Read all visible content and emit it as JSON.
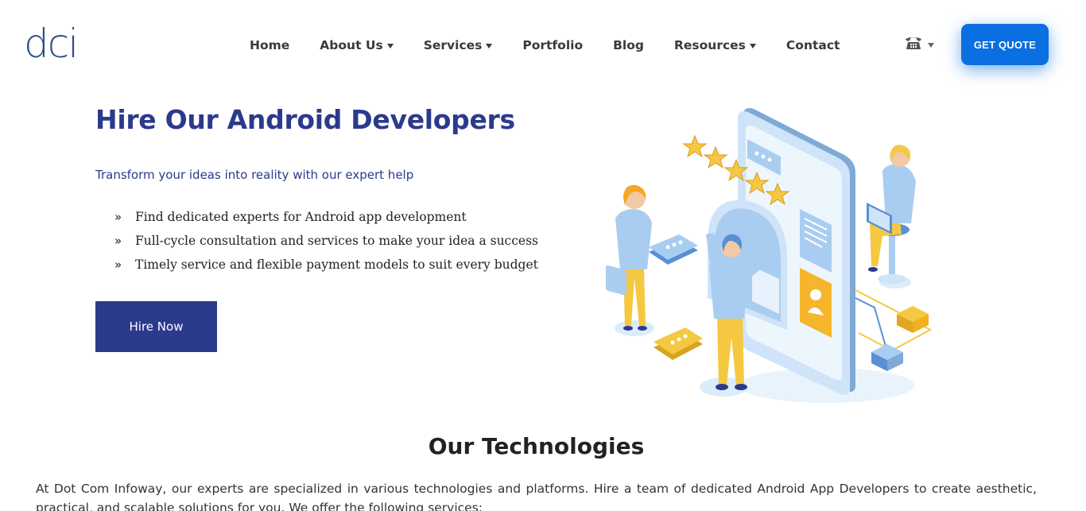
{
  "header": {
    "logo_text": "dci",
    "nav": [
      {
        "label": "Home",
        "dropdown": false
      },
      {
        "label": "About Us",
        "dropdown": true
      },
      {
        "label": "Services",
        "dropdown": true
      },
      {
        "label": "Portfolio",
        "dropdown": false
      },
      {
        "label": "Blog",
        "dropdown": false
      },
      {
        "label": "Resources",
        "dropdown": true
      },
      {
        "label": "Contact",
        "dropdown": false
      }
    ],
    "phone_icon": "phone-icon",
    "cta_label": "GET QUOTE"
  },
  "hero": {
    "title": "Hire Our Android Developers",
    "subtitle": "Transform your ideas into reality with our expert help",
    "bullet_icon": "»",
    "bullets": [
      "Find dedicated experts for Android app development",
      "Full-cycle consultation and services to make your idea a success",
      "Timely service and flexible payment models to suit every budget"
    ],
    "button_label": "Hire Now"
  },
  "technologies": {
    "title": "Our Technologies",
    "intro": "At Dot Com Infoway, our experts are specialized in various technologies and platforms. Hire a team of dedicated Android App Developers to create aesthetic, practical, and scalable solutions for you. We offer the following services:"
  },
  "colors": {
    "brand_navy": "#2c3a8c",
    "cta_blue": "#0a6fe0",
    "logo_blue": "#2d4f8a",
    "illustration_blue": "#a9cdf0",
    "illustration_yellow": "#f5c842"
  }
}
